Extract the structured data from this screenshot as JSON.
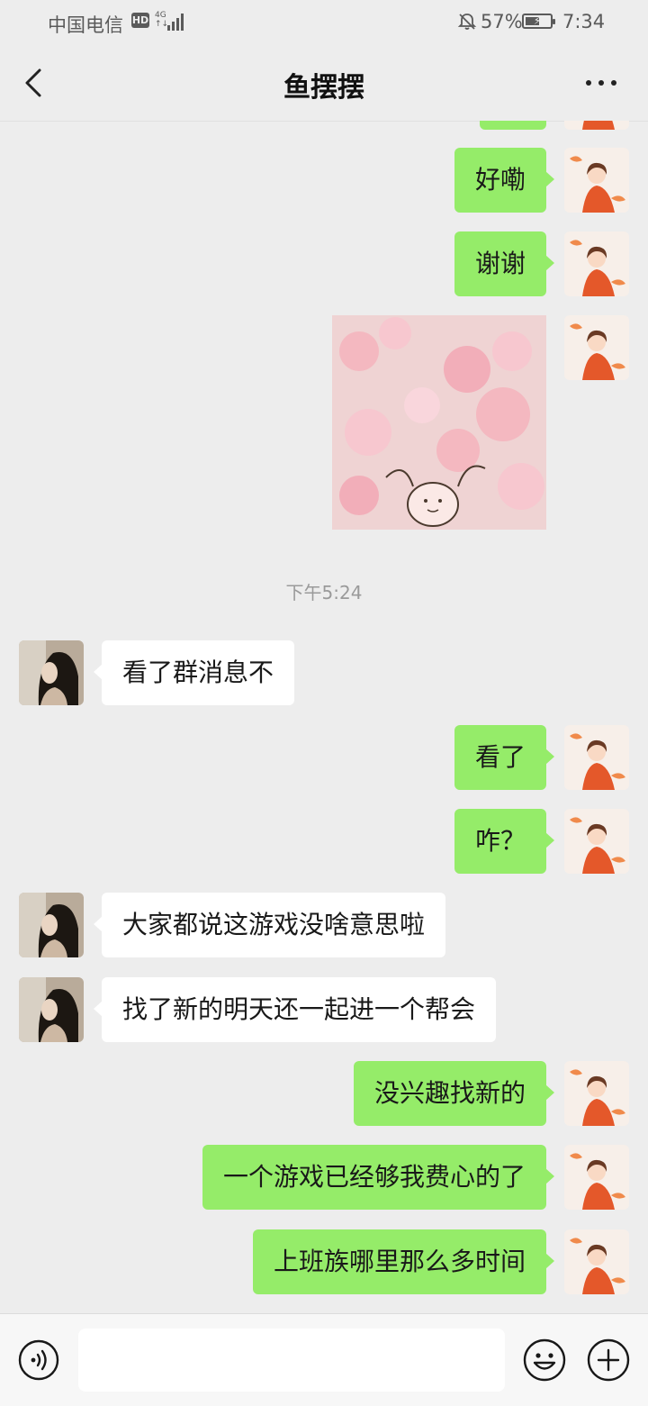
{
  "status_bar": {
    "carrier": "中国电信",
    "hd_badge": "HD",
    "network_top": "4G",
    "network_bottom": "↑↓",
    "battery_percent": "57%",
    "battery_level": 0.57,
    "time": "7:34"
  },
  "header": {
    "title": "鱼摆摆"
  },
  "messages": [
    {
      "side": "me",
      "text": "好嘞"
    },
    {
      "side": "me",
      "text": "谢谢"
    },
    {
      "side": "me",
      "type": "sticker",
      "description": "pink blossom sticker"
    },
    {
      "type": "time",
      "text": "下午5:24"
    },
    {
      "side": "other",
      "text": "看了群消息不"
    },
    {
      "side": "me",
      "text": "看了"
    },
    {
      "side": "me",
      "text": "咋？"
    },
    {
      "side": "other",
      "text": "大家都说这游戏没啥意思啦"
    },
    {
      "side": "other",
      "text": "找了新的明天还一起进一个帮会"
    },
    {
      "side": "me",
      "text": "没兴趣找新的"
    },
    {
      "side": "me",
      "text": "一个游戏已经够我费心的了"
    },
    {
      "side": "me",
      "text": "上班族哪里那么多时间"
    }
  ],
  "input": {
    "value": "",
    "placeholder": ""
  },
  "colors": {
    "me_bubble": "#95ec69",
    "other_bubble": "#ffffff",
    "background": "#ededed"
  }
}
